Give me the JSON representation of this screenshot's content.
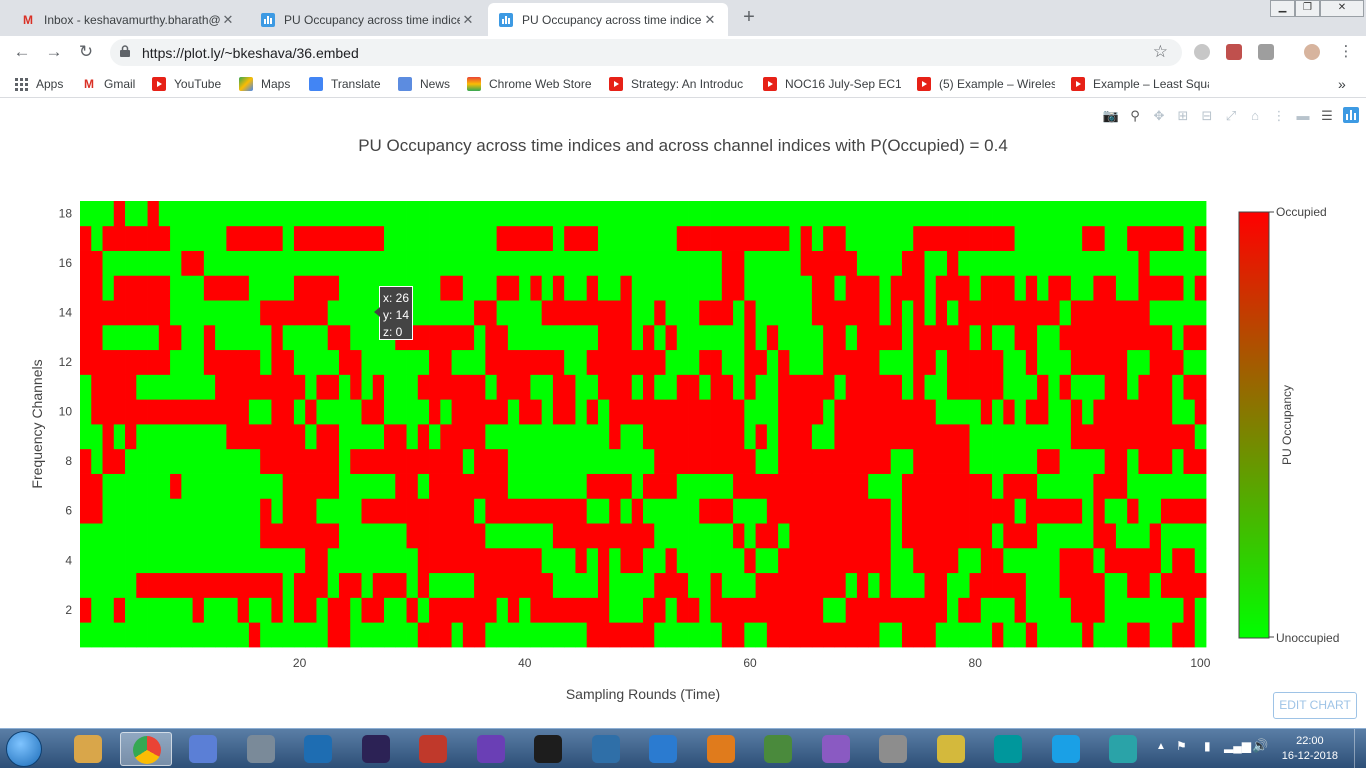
{
  "browser": {
    "tabs": [
      {
        "title": "Inbox - keshavamurthy.bharath@",
        "icon": "gmail-icon",
        "active": false
      },
      {
        "title": "PU Occupancy across time indice",
        "icon": "plotly-icon",
        "active": false
      },
      {
        "title": "PU Occupancy across time indice",
        "icon": "plotly-icon",
        "active": true
      }
    ],
    "url": "https://plot.ly/~bkeshava/36.embed",
    "bookmarks": [
      {
        "label": "Apps",
        "icon": "apps-grid-icon"
      },
      {
        "label": "Gmail",
        "icon": "gmail-icon"
      },
      {
        "label": "YouTube",
        "icon": "youtube-icon"
      },
      {
        "label": "Maps",
        "icon": "maps-icon"
      },
      {
        "label": "Translate",
        "icon": "translate-icon"
      },
      {
        "label": "News",
        "icon": "news-icon"
      },
      {
        "label": "Chrome Web Store",
        "icon": "chrome-web-store-icon"
      },
      {
        "label": "Strategy: An Introduc",
        "icon": "youtube-icon"
      },
      {
        "label": "NOC16 July-Sep EC1!",
        "icon": "youtube-icon"
      },
      {
        "label": "(5) Example – Wireles",
        "icon": "youtube-icon"
      },
      {
        "label": "Example – Least Squa",
        "icon": "youtube-icon"
      }
    ],
    "more_bookmarks": "»"
  },
  "chart_data": {
    "type": "heatmap",
    "title": "PU Occupancy across time indices and across channel indices with P(Occupied) = 0.4",
    "xlabel": "Sampling Rounds (Time)",
    "ylabel": "Frequency Channels",
    "x_range": [
      1,
      100
    ],
    "y_range": [
      1,
      18
    ],
    "x_ticks": [
      20,
      40,
      60,
      80,
      100
    ],
    "y_ticks": [
      2,
      4,
      6,
      8,
      10,
      12,
      14,
      16,
      18
    ],
    "colorscale": {
      "low": "#00ff00",
      "high": "#ff0000"
    },
    "colorbar": {
      "title": "PU Occupancy",
      "top_label": "Occupied",
      "bottom_label": "Unoccupied"
    },
    "occupied_probability": 0.4,
    "rows_note": "z values: 1 = Occupied, 0 = Unoccupied; rows listed from channel 1 (bottom) to 18 (top), columns = time 1..100",
    "z": [
      "0000000000000001000000110000001110110000000001111110000001100111111111100111000001001000010001100110",
      "1001000000100010010110110110010111111010111111100011011011111111110011111111101100010000111000000010",
      "0000011111111111110111011011101000011111110000100001110010001111111101010001100111110001111001101111",
      "0000000000000000000011000000001111111111100010101100100000010011111111110011110011000001110111110110",
      "0000000000000000111111100000011111110000001111111110000000101101111111110111111110111000001100010000",
      "1100000000000000101110000111111111101111111110010100000111000111111111110111111111101111101001001111",
      "1100000010000000001111100000110111111100000001111011100000111111111111000111111110111000001110000000",
      "1011000000000000111111101111111111011100000000000001111111110011111111110011111000000110000110111011",
      "0010100000000111111101100001101011110000000000010011111111101011100111111111111000000000111111111110",
      "0111111111111110011010000110000101111101101101011111111111100011110111111111000010101100101111111001",
      "0111100000001111111101101010001111110111001100111010011011010011111011111010011111000101000110111011",
      "1111111100011111011000011000000110001111111001111111000110011010001111100011011111001000111110011100",
      "1100000110010000010000110000111111101100000000111010100000010100001101111011111010011001111111111011",
      "1111111100000000111111000000000000011000011111111001000111010000011111101010101111111110111111100000",
      "1101111100011110000111100000000011000110101001001000000001100000011011101110111011101011001100111101",
      "1100000001100000000000000000000000000000000000000000000001100000111110000110010000000000000000100000",
      "1011111100000111110111111110000000000111110111000000011111111110101100000011111111100000011001111101",
      "0001001000000000000000000000000000000000000000000000000000000000000000000000000000000000000000000000"
    ],
    "hover": {
      "x": 26,
      "y": 14,
      "z": 0
    }
  },
  "plot_ui": {
    "edit_chart": "EDIT CHART",
    "hover_lines": [
      "x: 26",
      "y: 14",
      "z: 0"
    ],
    "modebar": [
      "camera-icon",
      "zoom-icon",
      "pan-icon",
      "zoom-in-icon",
      "zoom-out-icon",
      "autoscale-icon",
      "reset-axes-icon",
      "spike-lines-icon",
      "hover-closest-icon",
      "hover-compare-icon",
      "plotly-logo-icon"
    ]
  },
  "taskbar": {
    "clock_time": "22:00",
    "clock_date": "16-12-2018",
    "apps": [
      "explorer",
      "chrome",
      "network-tool",
      "security-tool",
      "wireshark",
      "eclipse",
      "ruby",
      "visual-studio",
      "pycharm",
      "python",
      "go",
      "matlab",
      "editor",
      "github",
      "database",
      "app",
      "arduino",
      "skype",
      "misc"
    ]
  }
}
